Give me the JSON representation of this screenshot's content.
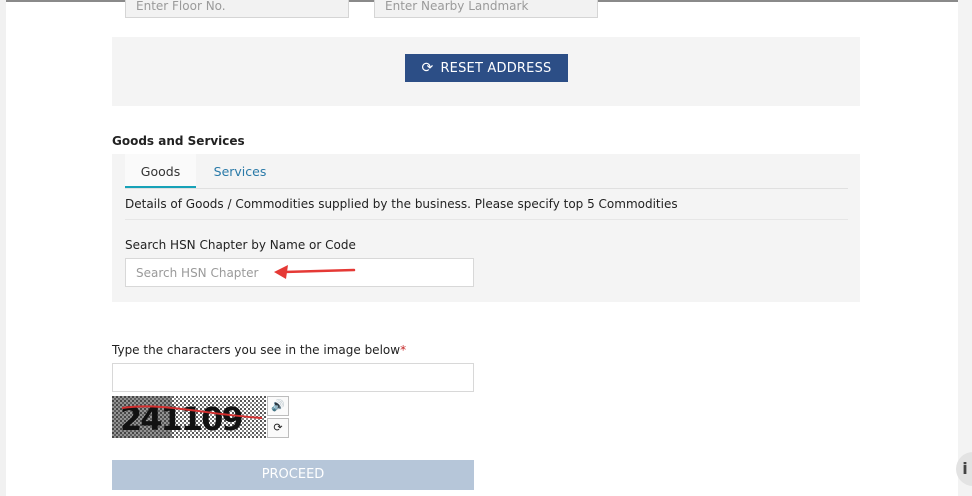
{
  "address": {
    "floor_placeholder": "Enter Floor No.",
    "landmark_placeholder": "Enter Nearby Landmark",
    "reset_label": "RESET ADDRESS"
  },
  "goods_services": {
    "title": "Goods and Services",
    "tabs": [
      {
        "label": "Goods",
        "active": true
      },
      {
        "label": "Services",
        "active": false
      }
    ],
    "description": "Details of Goods / Commodities supplied by the business. Please specify top 5 Commodities",
    "hsn_label": "Search HSN Chapter by Name or Code",
    "hsn_placeholder": "Search HSN Chapter",
    "hsn_value": ""
  },
  "captcha": {
    "label": "Type the characters you see in the image below",
    "required_mark": "*",
    "input_value": "",
    "image_text": "241109",
    "audio_icon": "speaker-icon",
    "refresh_icon": "refresh-icon"
  },
  "actions": {
    "proceed_label": "PROCEED",
    "help_label": "i"
  },
  "colors": {
    "primary": "#2c4e86",
    "tab_accent": "#17a2b8",
    "link": "#2a7aa8",
    "disabled": "#b6c6d9",
    "annotation_arrow": "#e53935"
  }
}
